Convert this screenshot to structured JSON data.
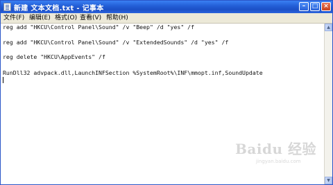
{
  "window": {
    "title": "新建 文本文档.txt - 记事本",
    "buttons": {
      "minimize": "–",
      "maximize": "□",
      "close": "×"
    }
  },
  "menu": [
    "文件(F)",
    "编辑(E)",
    "格式(O)",
    "查看(V)",
    "帮助(H)"
  ],
  "editor": {
    "lines": [
      "reg add \"HKCU\\Control Panel\\Sound\" /v \"Beep\" /d \"yes\" /f",
      "reg add \"HKCU\\Control Panel\\Sound\" /v \"ExtendedSounds\" /d \"yes\" /f",
      "reg delete \"HKCU\\AppEvents\" /f",
      "RunDll32 advpack.dll,LaunchINFSection %SystemRoot%\\INF\\mmopt.inf,SoundUpdate"
    ]
  },
  "scrollbar": {
    "up": "▲",
    "down": "▼"
  },
  "watermark": {
    "brand": "Baidu 经验",
    "url": "jingyan.baidu.com"
  },
  "icons": {
    "app": "notepad-icon",
    "scroll_up": "scroll-up-arrow-icon",
    "scroll_down": "scroll-down-arrow-icon"
  }
}
